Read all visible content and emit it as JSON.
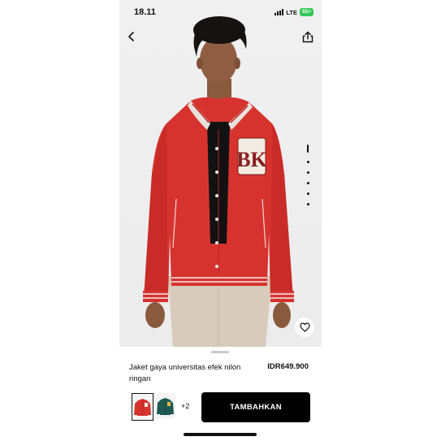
{
  "status": {
    "time": "18.11",
    "network": "LTE",
    "battery": "55+"
  },
  "product": {
    "title": "Jaket gaya universitas efek nilon ringan",
    "price": "IDR649.900",
    "monogram": "BK",
    "colors_more": "+2"
  },
  "actions": {
    "add_label": "TAMBAHKAN"
  },
  "icons": {
    "back": "chevron-left-icon",
    "share": "share-icon",
    "wishlist": "heart-icon"
  },
  "carousel": {
    "total": 6,
    "active": 1
  },
  "colors": {
    "jacket": "#d7332e",
    "battery": "#34c759",
    "button": "#000000"
  }
}
